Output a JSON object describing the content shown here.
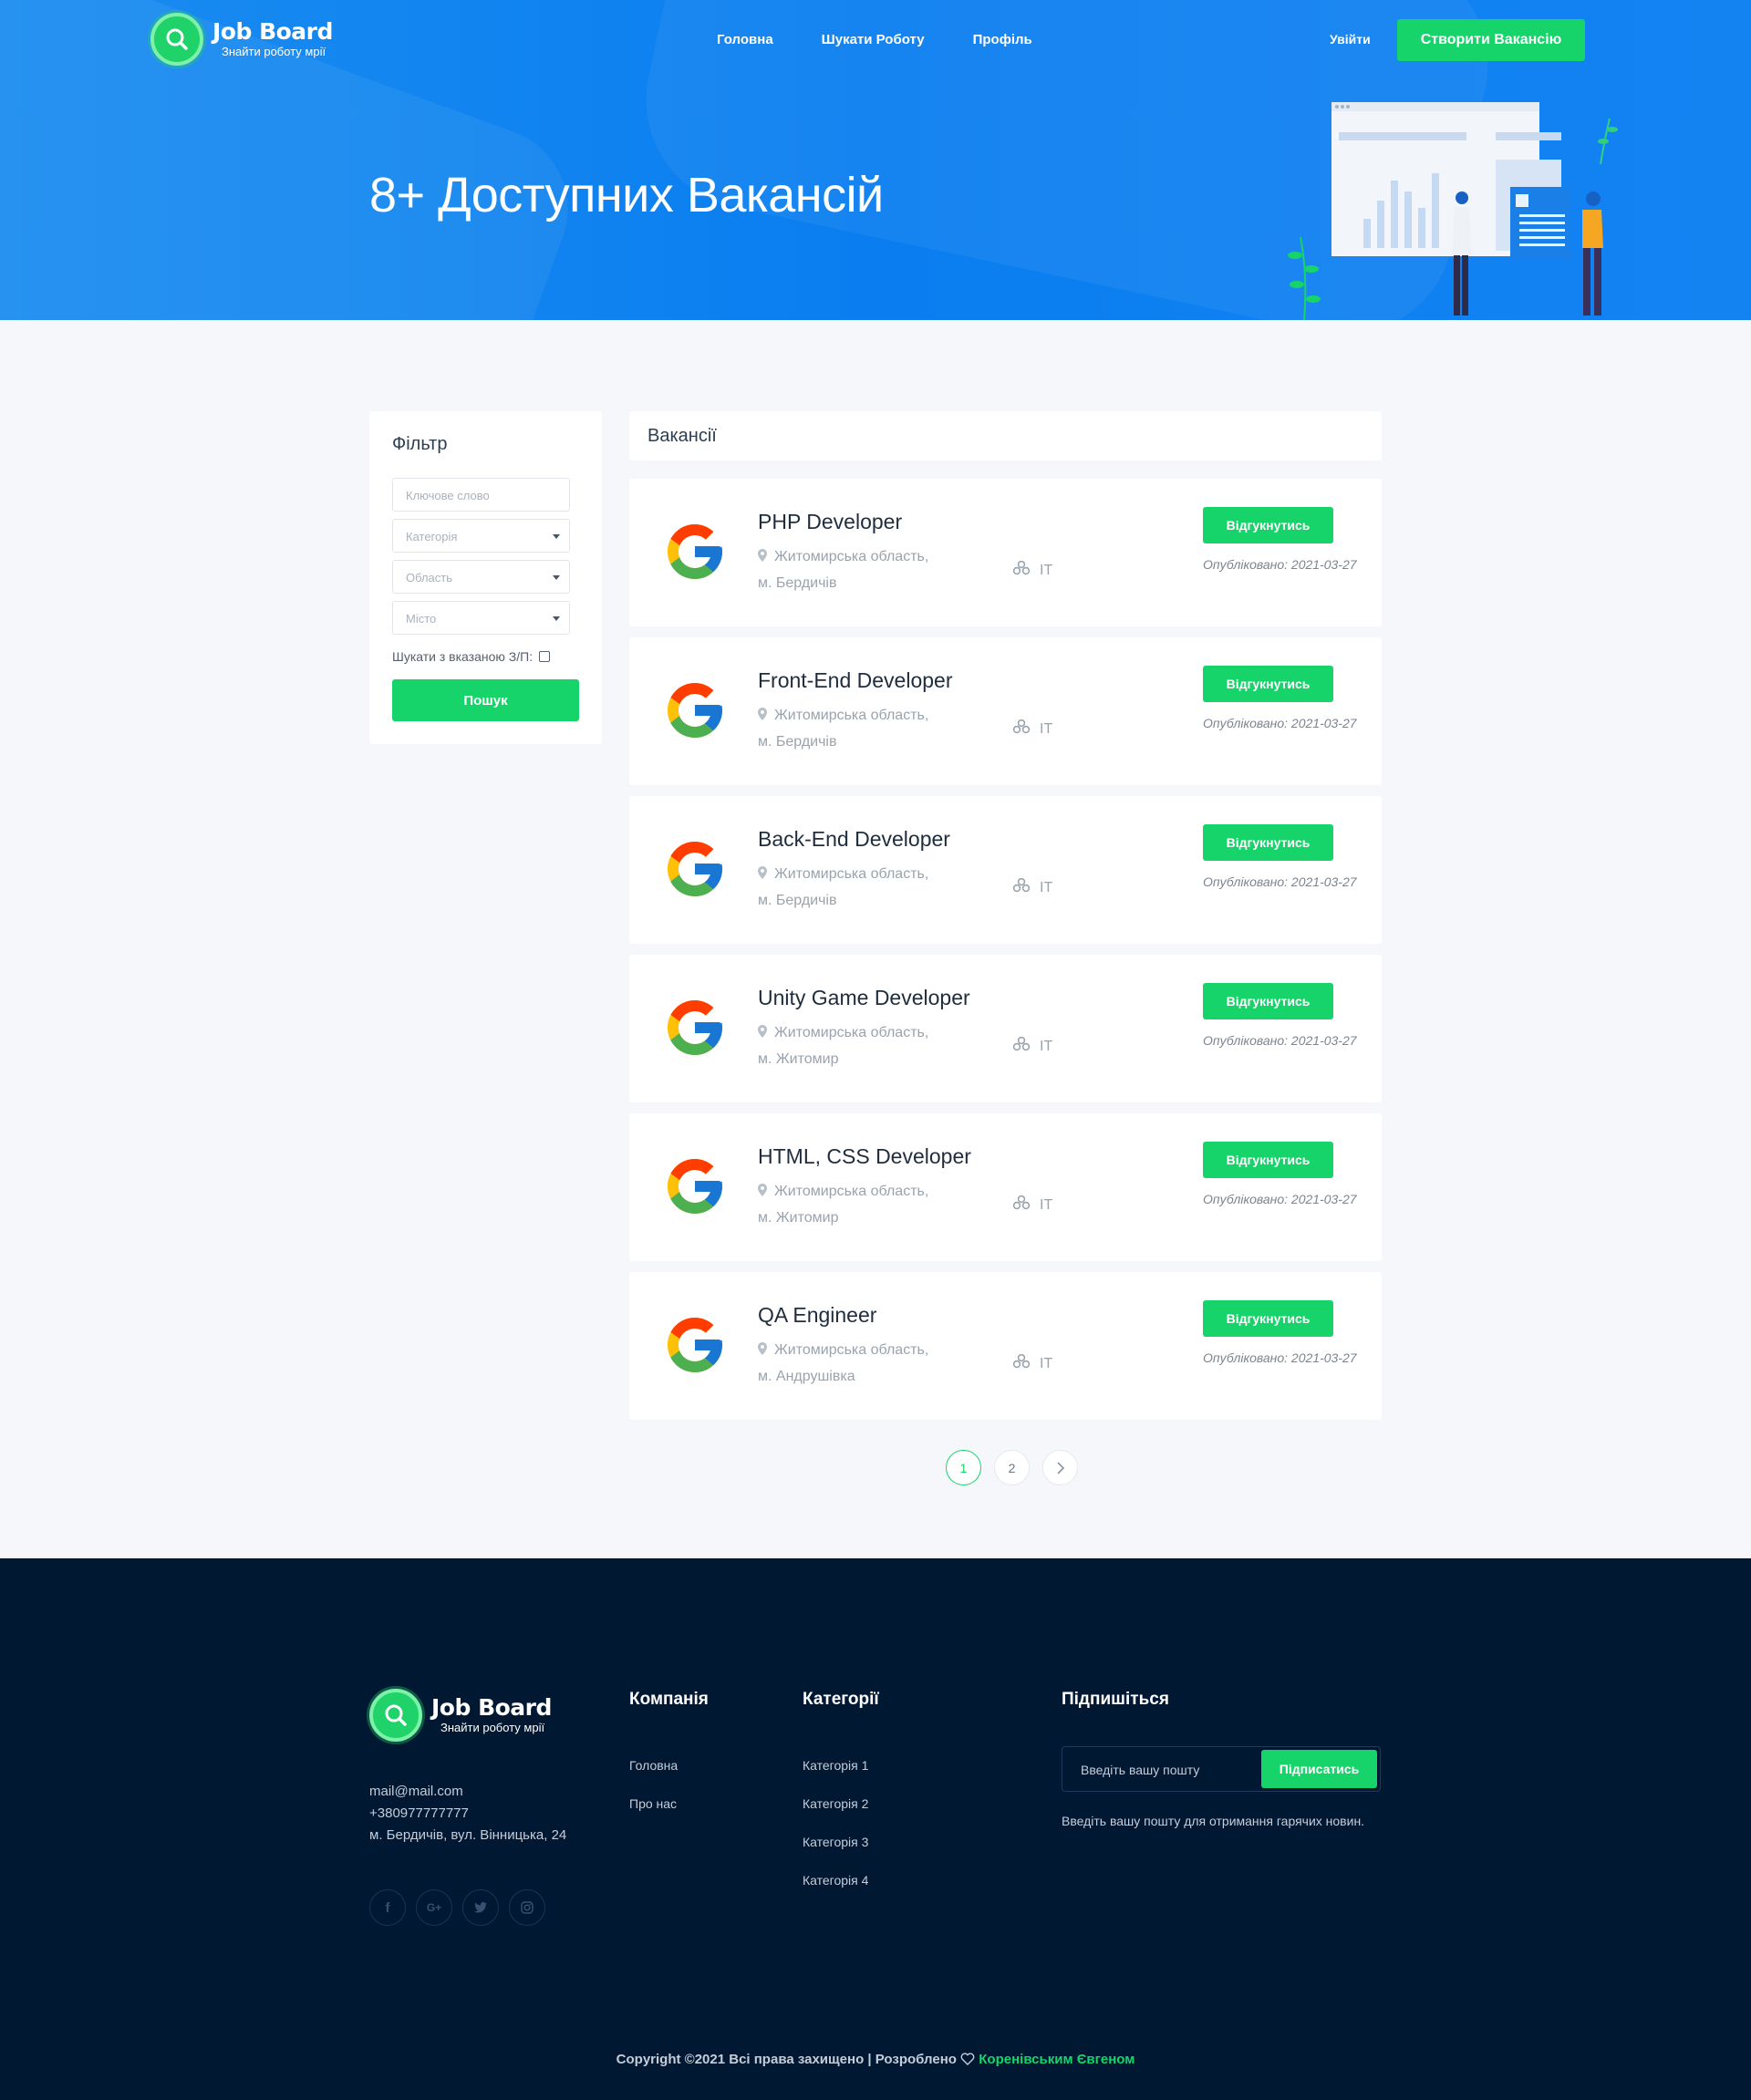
{
  "brand": {
    "name": "Job Board",
    "tagline": "Знайти роботу мрії",
    "accent": "#16d46a",
    "hero_color": "#0a7ef0",
    "footer_color": "#011833"
  },
  "nav": {
    "items": [
      "Головна",
      "Шукати Роботу",
      "Профіль"
    ],
    "login": "Увійти",
    "create": "Створити Вакансію"
  },
  "hero": {
    "title": "8+ Доступних Вакансій"
  },
  "filter": {
    "title": "Фільтр",
    "keyword_placeholder": "Ключове слово",
    "category": "Категорія",
    "region": "Область",
    "city": "Місто",
    "salary_label": "Шукати з вказаною З/П:",
    "search_button": "Пошук"
  },
  "jobs_header": "Вакансії",
  "jobs": [
    {
      "title": "PHP Developer",
      "region": "Житомирська область,",
      "city": "м. Бердичів",
      "category": "IT",
      "apply": "Відгукнутись",
      "posted": "Опубліковано: 2021-03-27",
      "logo_icon": "google-logo"
    },
    {
      "title": "Front-End Developer",
      "region": "Житомирська область,",
      "city": "м. Бердичів",
      "category": "IT",
      "apply": "Відгукнутись",
      "posted": "Опубліковано: 2021-03-27",
      "logo_icon": "google-logo"
    },
    {
      "title": "Back-End Developer",
      "region": "Житомирська область,",
      "city": "м. Бердичів",
      "category": "IT",
      "apply": "Відгукнутись",
      "posted": "Опубліковано: 2021-03-27",
      "logo_icon": "google-logo"
    },
    {
      "title": "Unity Game Developer",
      "region": "Житомирська область,",
      "city": "м. Житомир",
      "category": "IT",
      "apply": "Відгукнутись",
      "posted": "Опубліковано: 2021-03-27",
      "logo_icon": "google-logo"
    },
    {
      "title": "HTML, CSS Developer",
      "region": "Житомирська область,",
      "city": "м. Житомир",
      "category": "IT",
      "apply": "Відгукнутись",
      "posted": "Опубліковано: 2021-03-27",
      "logo_icon": "google-logo"
    },
    {
      "title": "QA Engineer",
      "region": "Житомирська область,",
      "city": "м. Андрушівка",
      "category": "IT",
      "apply": "Відгукнутись",
      "posted": "Опубліковано: 2021-03-27",
      "logo_icon": "google-logo"
    }
  ],
  "pagination": {
    "pages": [
      "1",
      "2"
    ],
    "current": "1",
    "next_icon": "chevron-right-icon"
  },
  "footer": {
    "email": "mail@mail.com",
    "phone": "+380977777777",
    "address": "м. Бердичів, вул. Вінницька, 24",
    "socials": [
      "facebook-icon",
      "google-plus-icon",
      "twitter-icon",
      "instagram-icon"
    ],
    "company": {
      "title": "Компанія",
      "links": [
        "Головна",
        "Про нас"
      ]
    },
    "categories": {
      "title": "Категорії",
      "links": [
        "Категорія 1",
        "Категорія 2",
        "Категорія 3",
        "Категорія 4"
      ]
    },
    "subscribe": {
      "title": "Підпишіться",
      "placeholder": "Введіть вашу пошту",
      "button": "Підписатись",
      "note": "Введіть вашу пошту для отримання гарячих новин."
    },
    "copyright": "Copyright ©2021 Всі права захищено | Розроблено",
    "author": "Коренівським Євгеном"
  }
}
